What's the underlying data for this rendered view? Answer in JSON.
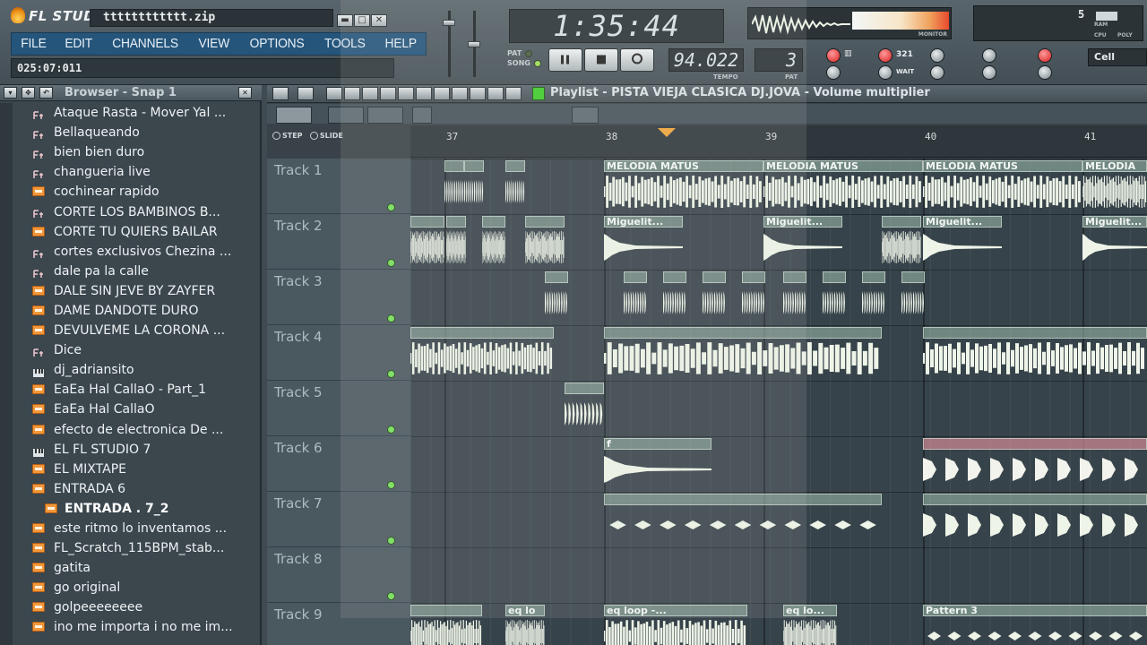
{
  "app": {
    "logo_text": "FL STUDIO",
    "project_name": "tttttttttttt.zip",
    "win_btn_min": "▬",
    "win_btn_max": "□",
    "win_btn_close": "✕",
    "hint": "025:07:011"
  },
  "menu": [
    "FILE",
    "EDIT",
    "CHANNELS",
    "VIEW",
    "OPTIONS",
    "TOOLS",
    "HELP"
  ],
  "transport": {
    "time": "1:35:44",
    "pat_label": "PAT",
    "song_label": "SONG",
    "tempo": "94.022",
    "tempo_label": "TEMPO",
    "pat_value": "3",
    "pat_value_label": "PAT"
  },
  "monitor": {
    "label": "MONITOR"
  },
  "cpu": {
    "value": "5",
    "ram_label": "RAM",
    "cpu_label": "CPU",
    "poly_label": "POLY"
  },
  "snap": {
    "value": "Cell"
  },
  "tool_labels": {
    "step_icon": "321",
    "wait": "WAIT"
  },
  "browser": {
    "title": "Browser - Snap 1",
    "items": [
      {
        "label": "Ataque Rasta - Mover Yal ...",
        "icon": "wave-icon"
      },
      {
        "label": "Bellaqueando",
        "icon": "wave-icon"
      },
      {
        "label": "bien bien duro",
        "icon": "wave-icon"
      },
      {
        "label": "changueria live",
        "icon": "wave-icon"
      },
      {
        "label": "cochinear rapido",
        "icon": "folder-icon"
      },
      {
        "label": "CORTE LOS BAMBINOS B...",
        "icon": "wave-icon"
      },
      {
        "label": "CORTE TU QUIERS BAILAR",
        "icon": "folder-icon"
      },
      {
        "label": "cortes exclusivos Chezina ...",
        "icon": "wave-icon"
      },
      {
        "label": "dale pa la calle",
        "icon": "wave-icon"
      },
      {
        "label": "DALE SIN JEVE BY ZAYFER",
        "icon": "folder-icon"
      },
      {
        "label": "DAME DANDOTE DURO",
        "icon": "folder-icon"
      },
      {
        "label": "DEVULVEME LA CORONA ...",
        "icon": "folder-icon"
      },
      {
        "label": "Dice",
        "icon": "wave-icon"
      },
      {
        "label": "dj_adriansito",
        "icon": "piano-icon"
      },
      {
        "label": "EaEa Hal CallaO - Part_1",
        "icon": "folder-icon"
      },
      {
        "label": "EaEa Hal CallaO",
        "icon": "folder-icon"
      },
      {
        "label": "efecto de electronica De ...",
        "icon": "folder-icon"
      },
      {
        "label": "EL FL STUDIO 7",
        "icon": "piano-icon"
      },
      {
        "label": "EL MIXTAPE",
        "icon": "folder-icon"
      },
      {
        "label": "ENTRADA    6",
        "icon": "folder-icon"
      },
      {
        "label": "ENTRADA .    7_2",
        "icon": "folder-icon",
        "active": true
      },
      {
        "label": "este ritmo lo inventamos ...",
        "icon": "folder-icon"
      },
      {
        "label": "FL_Scratch_115BPM_stab...",
        "icon": "folder-icon"
      },
      {
        "label": "gatita",
        "icon": "folder-icon"
      },
      {
        "label": "go original",
        "icon": "folder-icon"
      },
      {
        "label": "golpeeeeeeee",
        "icon": "folder-icon"
      },
      {
        "label": "ino me importa i no me im...",
        "icon": "folder-icon"
      }
    ]
  },
  "playlist": {
    "title": "Playlist - PISTA VIEJA CLASICA DJ.JOVA - Volume multiplier",
    "step_label": "STEP",
    "slide_label": "SLIDE",
    "ruler": [
      "37",
      "38",
      "39",
      "40",
      "41"
    ],
    "tracks": [
      "Track 1",
      "Track 2",
      "Track 3",
      "Track 4",
      "Track 5",
      "Track 6",
      "Track 7",
      "Track 8",
      "Track 9"
    ],
    "clip_names": {
      "melodia": "MELODIA MATUS",
      "melodia_cut": "MELODIA",
      "miguel": "Miguelit...",
      "f": "f",
      "eq_loop": "eq loop -...",
      "eq_lo": "eq lo...",
      "eq_short": "eq lo",
      "pattern3": "Pattern 3"
    }
  },
  "colors": {
    "menu_bg": "#25557b",
    "wave": "#eef4e8",
    "accent_green": "#3fcb2a",
    "marker": "#f2a53b"
  }
}
